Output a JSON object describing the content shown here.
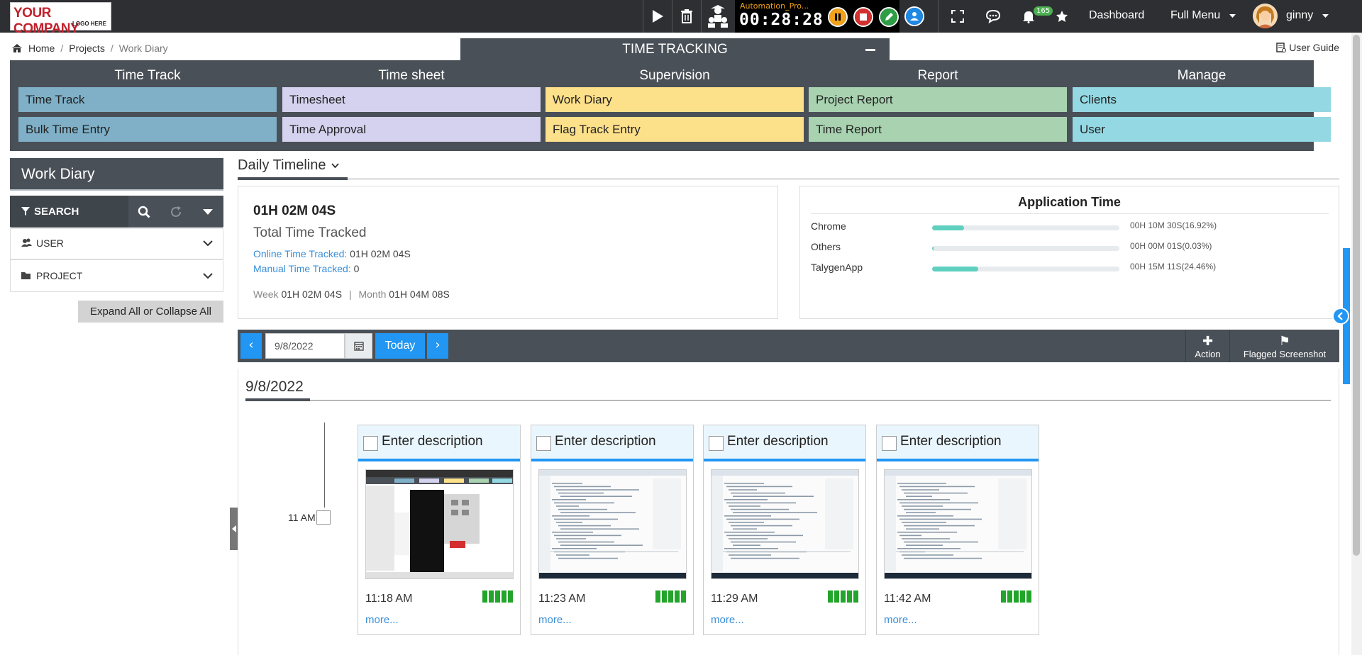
{
  "header": {
    "logo_line1": "YOUR COMPANY",
    "logo_line2": "LOGO HERE",
    "timer_project": "Automation_Pro...",
    "timer_clock": "00:28:28",
    "notifications_count": "165",
    "dashboard_label": "Dashboard",
    "full_menu_label": "Full Menu",
    "user_name": "ginny"
  },
  "breadcrumb": {
    "home": "Home",
    "projects": "Projects",
    "current": "Work Diary"
  },
  "user_guide": "User Guide",
  "time_tracking": {
    "title": "TIME TRACKING",
    "columns": [
      {
        "header": "Time Track",
        "items": [
          "Time Track",
          "Bulk Time Entry"
        ],
        "color": "#7fb0c7"
      },
      {
        "header": "Time sheet",
        "items": [
          "Timesheet",
          "Time Approval"
        ],
        "color": "#d4d2ee"
      },
      {
        "header": "Supervision",
        "items": [
          "Work Diary",
          "Flag Track Entry"
        ],
        "color": "#fde08a"
      },
      {
        "header": "Report",
        "items": [
          "Project Report",
          "Time Report"
        ],
        "color": "#a8d2b0"
      },
      {
        "header": "Manage",
        "items": [
          "Clients",
          "User"
        ],
        "color": "#93d8e2"
      }
    ]
  },
  "sidebar": {
    "title": "Work Diary",
    "search_label": "SEARCH",
    "filters": [
      "USER",
      "PROJECT"
    ],
    "expand_label": "Expand All or Collapse All"
  },
  "timeline": {
    "title": "Daily Timeline",
    "total_time": "01H 02M 04S",
    "total_label": "Total Time Tracked",
    "online_label": "Online Time Tracked:",
    "online_value": "01H 02M 04S",
    "manual_label": "Manual Time Tracked:",
    "manual_value": "0",
    "week_label": "Week",
    "week_value": "01H 02M 04S",
    "month_label": "Month",
    "month_value": "01H 04M 08S"
  },
  "app_time": {
    "title": "Application Time",
    "apps": [
      {
        "name": "Chrome",
        "value": "00H 10M 30S(16.92%)",
        "percent": 16.92
      },
      {
        "name": "Others",
        "value": "00H 00M 01S(0.03%)",
        "percent": 0.03
      },
      {
        "name": "TalygenApp",
        "value": "00H 15M 11S(24.46%)",
        "percent": 24.46
      }
    ]
  },
  "date_bar": {
    "date_value": "9/8/2022",
    "today_label": "Today",
    "action_label": "Action",
    "flagged_label": "Flagged Screenshot"
  },
  "diary": {
    "date_heading": "9/8/2022",
    "hour_label": "11 AM",
    "description_placeholder": "Enter description",
    "more_label": "more...",
    "screenshots": [
      {
        "time": "11:18 AM"
      },
      {
        "time": "11:23 AM"
      },
      {
        "time": "11:29 AM"
      },
      {
        "time": "11:42 AM"
      }
    ]
  }
}
